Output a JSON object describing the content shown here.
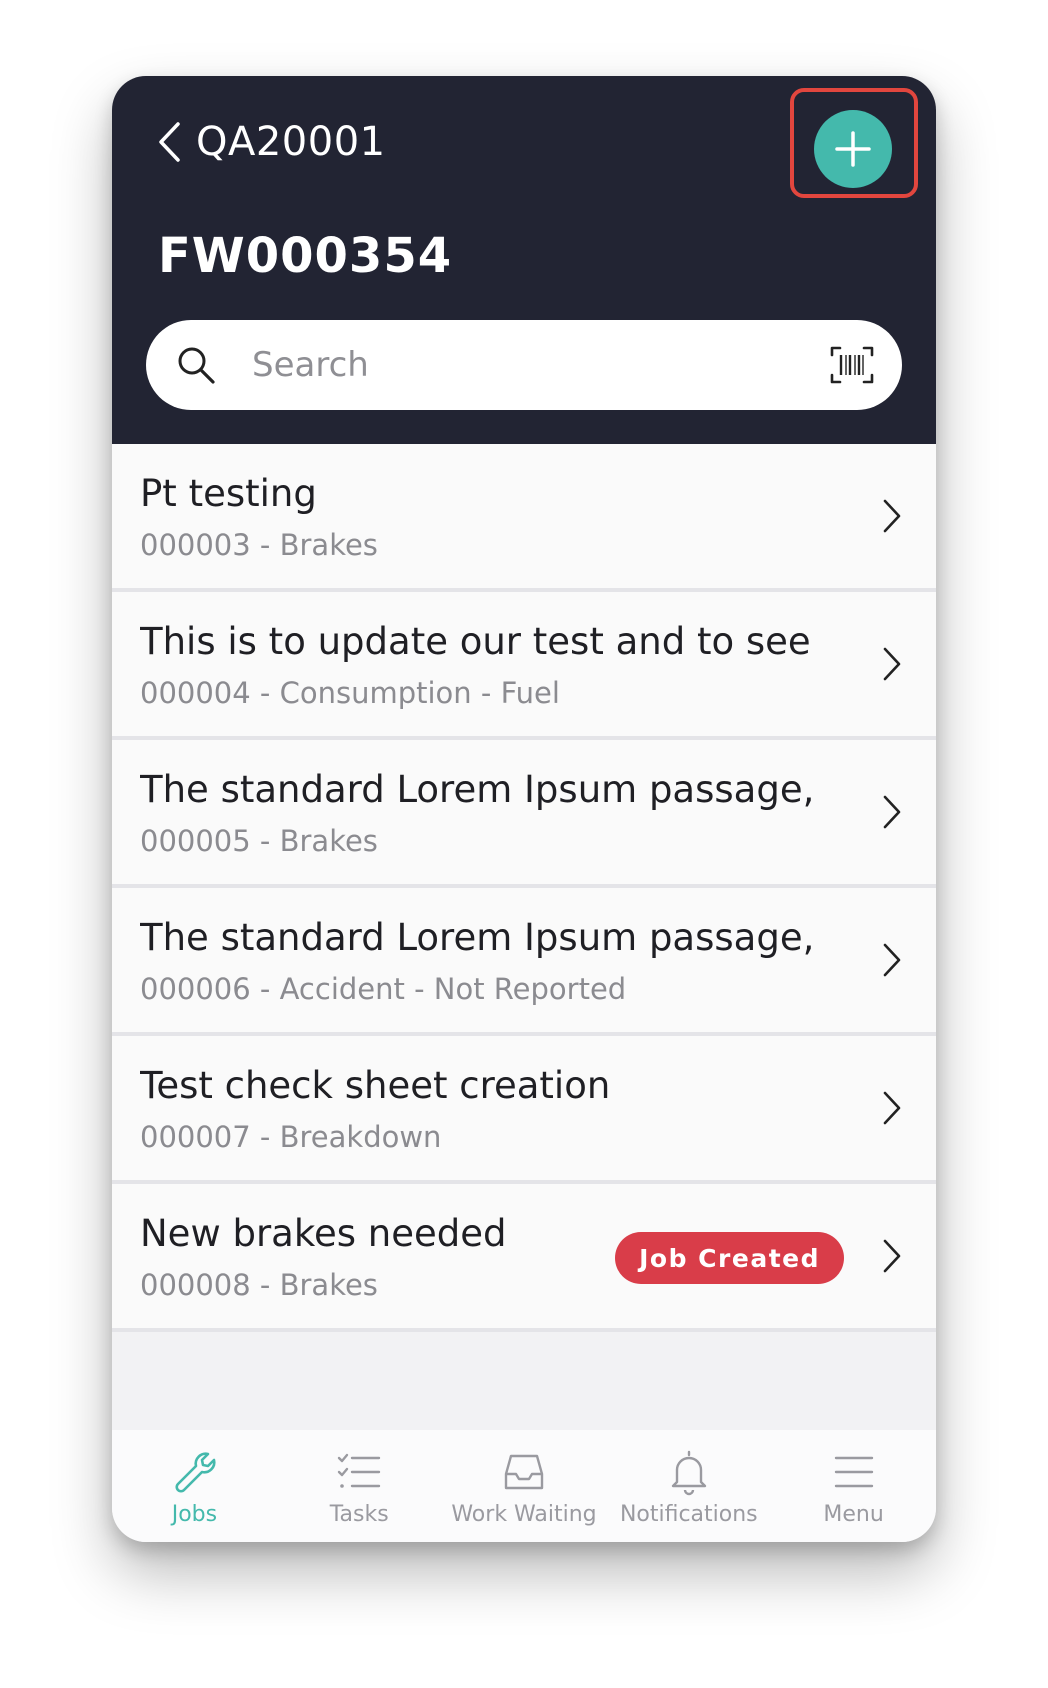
{
  "header": {
    "back_label": "QA20001",
    "title": "FW000354"
  },
  "search": {
    "placeholder": "Search"
  },
  "items": [
    {
      "title": "Pt testing",
      "subtitle": "000003 - Brakes"
    },
    {
      "title": "This is to update our test and to see ho…",
      "subtitle": "000004 - Consumption - Fuel"
    },
    {
      "title": "The standard Lorem Ipsum passage, u…",
      "subtitle": "000005 - Brakes"
    },
    {
      "title": "The standard Lorem Ipsum passage, u…",
      "subtitle": "000006 - Accident - Not Reported"
    },
    {
      "title": "Test check sheet creation",
      "subtitle": "000007 - Breakdown"
    },
    {
      "title": "New brakes needed",
      "subtitle": "000008 - Brakes",
      "badge": "Job Created"
    }
  ],
  "tabs": [
    {
      "label": "Jobs",
      "icon": "wrench-icon",
      "active": true
    },
    {
      "label": "Tasks",
      "icon": "checklist-icon"
    },
    {
      "label": "Work Waiting",
      "icon": "inbox-tray-icon"
    },
    {
      "label": "Notifications",
      "icon": "bell-icon"
    },
    {
      "label": "Menu",
      "icon": "hamburger-menu-icon"
    }
  ],
  "colors": {
    "header_bg": "#222433",
    "accent": "#44b9ac",
    "badge_bg": "#d93d49",
    "highlight_border": "#e2463e"
  }
}
